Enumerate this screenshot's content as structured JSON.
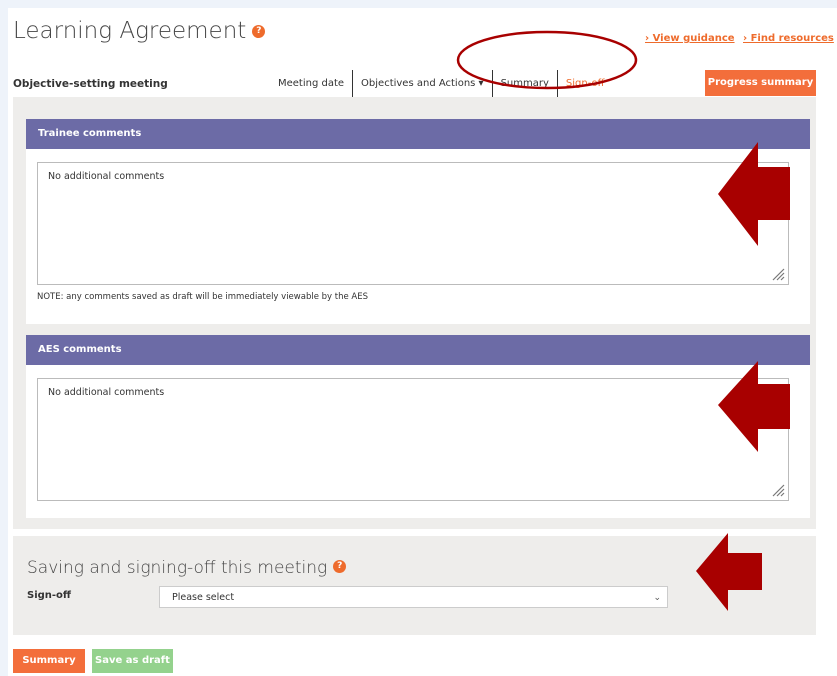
{
  "header": {
    "title": "Learning Agreement",
    "help_icon": "?",
    "links": {
      "view_guidance": "› View guidance",
      "find_resources": "› Find resources"
    }
  },
  "meeting": {
    "subtitle": "Objective-setting meeting",
    "tabs": [
      {
        "label": "Meeting date"
      },
      {
        "label": "Objectives and Actions ▾"
      },
      {
        "label": "Summary"
      },
      {
        "label": "Sign-off"
      }
    ],
    "progress_button": "Progress summary"
  },
  "trainee": {
    "heading": "Trainee comments",
    "text": "No additional comments",
    "note": "NOTE: any comments saved as draft will be immediately viewable by the AES"
  },
  "aes": {
    "heading": "AES comments",
    "text": "No additional comments"
  },
  "saving": {
    "title": "Saving and signing-off this meeting",
    "help_icon": "?",
    "signoff_label": "Sign-off",
    "select_value": "Please select",
    "chevron_icon": "⌄"
  },
  "buttons": {
    "summary": "Summary",
    "save_draft": "Save as draft"
  },
  "colors": {
    "accent": "#f36e3b",
    "panel_header": "#6c6ba6",
    "draft_button": "#94d28d",
    "annotation": "#a80000"
  }
}
